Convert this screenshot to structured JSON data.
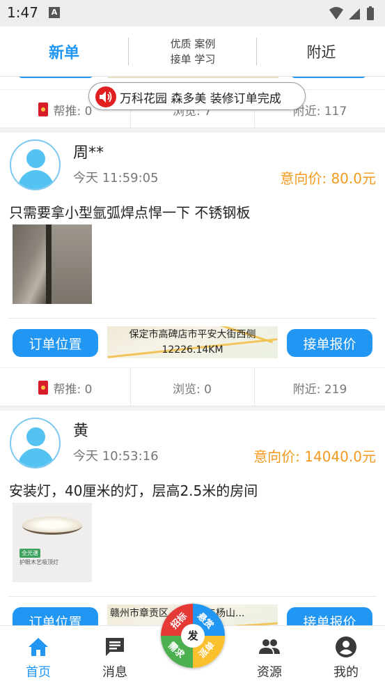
{
  "status_bar": {
    "time": "1:47",
    "notification_letter": "A"
  },
  "top_tabs": {
    "new_orders": "新单",
    "mid_line1": "优质 案例",
    "mid_line2": "接单 学习",
    "nearby": "附近"
  },
  "notice": {
    "text": "万科花园 森多美 装修订单完成"
  },
  "prev_stats": {
    "recommend": "帮推: 0",
    "views": "浏览: 7",
    "nearby": "附近: 117"
  },
  "orders": [
    {
      "name": "周**",
      "time": "今天 11:59:05",
      "price": "意向价: 80.0元",
      "description": "只需要拿小型氩弧焊点悍一下 不锈钢板",
      "image": "welding-photo",
      "location_button": "订单位置",
      "map_line1": "保定市高碑店市平安大街西侧",
      "map_line2": "12226.14KM",
      "quote_button": "接单报价",
      "stats": {
        "recommend": "帮推: 0",
        "views": "浏览: 0",
        "nearby": "附近: 219"
      }
    },
    {
      "name": "黄",
      "time": "今天 10:53:16",
      "price": "意向价: 14040.0元",
      "description": "安装灯，40厘米的灯，层高2.5米的房间",
      "image": "ceiling-lamp-photo",
      "image_tag": "全光谱",
      "image_caption": "护眼木艺吸顶灯",
      "location_button": "订单位置",
      "map_line1": "赣州市章贡区",
      "map_line1_suffix": "辅路与杨山...",
      "quote_button": "接单报价"
    }
  ],
  "fab": {
    "center": "发",
    "q1": "招标",
    "q2": "悬赏",
    "q3": "需求",
    "q4": "派单"
  },
  "bottom_nav": [
    {
      "label": "首页",
      "icon": "home-icon",
      "active": true
    },
    {
      "label": "消息",
      "icon": "message-icon",
      "active": false
    },
    {
      "label": "资源",
      "icon": "people-icon",
      "active": false
    },
    {
      "label": "我的",
      "icon": "account-icon",
      "active": false
    }
  ],
  "colors": {
    "accent": "#2196f3",
    "price": "#f39a1e",
    "notice_red": "#e02020"
  }
}
